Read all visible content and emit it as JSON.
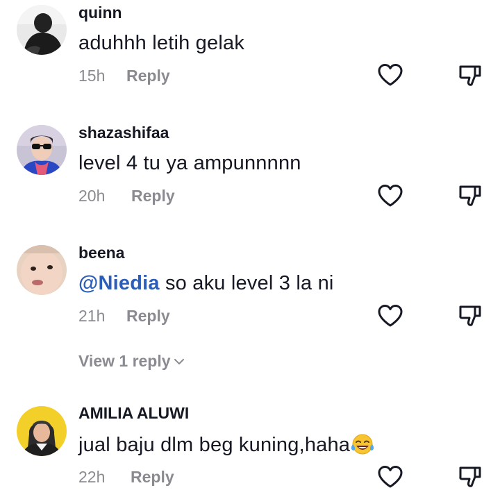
{
  "comments": [
    {
      "username": "quinn",
      "text": "aduhhh letih gelak",
      "time": "15h",
      "reply_label": "Reply"
    },
    {
      "username": "shazashifaa",
      "text": "level 4 tu ya ampunnnnn",
      "time": "20h",
      "reply_label": "Reply"
    },
    {
      "username": "beena",
      "mention": "@Niedia",
      "text": " so aku level 3 la ni",
      "time": "21h",
      "reply_label": "Reply",
      "view_replies": "View 1 reply"
    },
    {
      "username": "AMILIA ALUWI",
      "text": "jual baju dlm beg kuning,haha",
      "emoji": "face-with-tears-of-joy-icon",
      "time": "22h",
      "reply_label": "Reply"
    }
  ],
  "colors": {
    "text": "#161823",
    "muted": "#8a8b91",
    "mention": "#2b5db9",
    "icon_stroke": "#161823"
  }
}
